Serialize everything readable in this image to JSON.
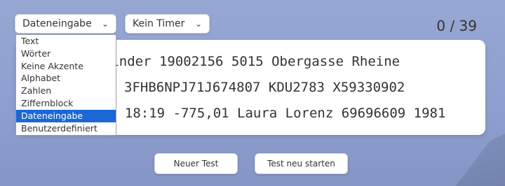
{
  "mode_select": {
    "value": "Dateneingabe"
  },
  "timer_select": {
    "value": "Kein Timer"
  },
  "counter": "0 / 39",
  "mode_options": [
    "Text",
    "Wörter",
    "Keine Akzente",
    "Alphabet",
    "Zahlen",
    "Ziffernblock",
    "Dateneingabe",
    "Benutzerdefiniert"
  ],
  "selected_option_index": 6,
  "text_lines": [
    "k Binder 19002156 5015 Obergasse Rheine",
    "3FHB6NPJ71J674807 KDU2783 X59330902",
    "5 18:19 -775,01 Laura Lorenz 69696609 1981"
  ],
  "buttons": {
    "new_test": "Neuer Test",
    "restart": "Test neu starten"
  },
  "colors": {
    "background": "#8e9fcf",
    "selected_option": "#1d67d5"
  }
}
